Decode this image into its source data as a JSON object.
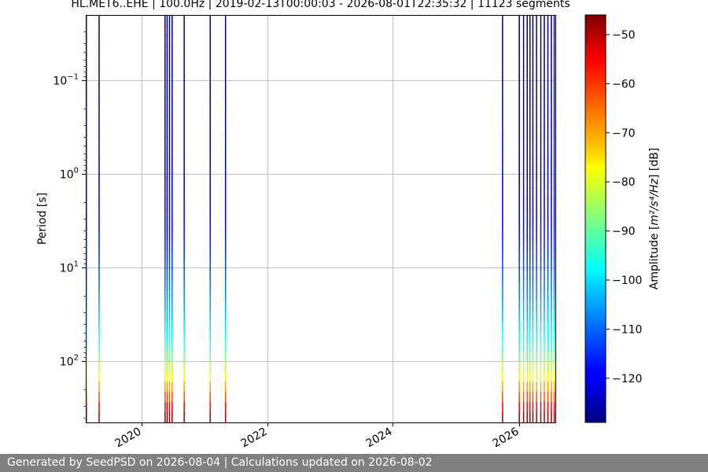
{
  "chart_data": {
    "type": "heatmap",
    "title": "HL.MET6..EHE | 100.0Hz | 2019-02-13T00:00:03 - 2026-08-01T22:35:32 | 11123 segments",
    "xlabel": "",
    "ylabel": "Period [s]",
    "x_axis": {
      "type": "date",
      "min": "2019-02-13",
      "max": "2026-08-01",
      "ticks": [
        "2020",
        "2022",
        "2024",
        "2026"
      ]
    },
    "y_axis": {
      "scale": "log",
      "inverted": true,
      "min": 0.02,
      "max": 450,
      "ticks": [
        {
          "value": 0.1,
          "base": "10",
          "exp": "−1"
        },
        {
          "value": 1,
          "base": "10",
          "exp": "0"
        },
        {
          "value": 10,
          "base": "10",
          "exp": "1"
        },
        {
          "value": 100,
          "base": "10",
          "exp": "2"
        }
      ]
    },
    "grid": true,
    "colorbar": {
      "label_prefix": "Amplitude [",
      "label_math": "m²/s⁴/Hz",
      "label_suffix": "] [dB]",
      "min": -129,
      "max": -46,
      "ticks": [
        "−50",
        "−60",
        "−70",
        "−80",
        "−90",
        "−100",
        "−110",
        "−120"
      ],
      "tick_values": [
        -50,
        -60,
        -70,
        -80,
        -90,
        -100,
        -110,
        -120
      ],
      "colormap": "jet"
    },
    "data_periods": [
      {
        "start": "2019-02-13",
        "end": "2019-02-16"
      },
      {
        "start": "2019-04-28",
        "end": "2019-05-03"
      },
      {
        "start": "2020-05-15",
        "end": "2020-05-18"
      },
      {
        "start": "2020-05-27",
        "end": "2020-05-30"
      },
      {
        "start": "2020-06-10",
        "end": "2020-06-13"
      },
      {
        "start": "2020-06-25",
        "end": "2020-06-28"
      },
      {
        "start": "2020-09-03",
        "end": "2020-09-05"
      },
      {
        "start": "2021-02-01",
        "end": "2021-02-04"
      },
      {
        "start": "2021-05-01",
        "end": "2021-05-03"
      },
      {
        "start": "2025-09-25",
        "end": "2025-09-28"
      },
      {
        "start": "2025-12-31",
        "end": "2026-01-03"
      },
      {
        "start": "2026-01-25",
        "end": "2026-01-30"
      },
      {
        "start": "2026-02-15",
        "end": "2026-02-20"
      },
      {
        "start": "2026-03-03",
        "end": "2026-03-09"
      },
      {
        "start": "2026-03-20",
        "end": "2026-03-27"
      },
      {
        "start": "2026-04-10",
        "end": "2026-04-15"
      },
      {
        "start": "2026-05-05",
        "end": "2026-05-10"
      },
      {
        "start": "2026-05-25",
        "end": "2026-06-01"
      },
      {
        "start": "2026-06-15",
        "end": "2026-06-20"
      },
      {
        "start": "2026-07-05",
        "end": "2026-07-10"
      },
      {
        "start": "2026-07-22",
        "end": "2026-07-28"
      }
    ],
    "amplitude_by_period": [
      {
        "period": 0.02,
        "db": -129
      },
      {
        "period": 0.1,
        "db": -128
      },
      {
        "period": 1,
        "db": -125
      },
      {
        "period": 3,
        "db": -120
      },
      {
        "period": 10,
        "db": -113
      },
      {
        "period": 30,
        "db": -104
      },
      {
        "period": 60,
        "db": -96
      },
      {
        "period": 100,
        "db": -86
      },
      {
        "period": 150,
        "db": -76
      },
      {
        "period": 200,
        "db": -68
      },
      {
        "period": 250,
        "db": -62
      },
      {
        "period": 300,
        "db": -57
      },
      {
        "period": 400,
        "db": -48
      },
      {
        "period": 450,
        "db": -46
      }
    ]
  },
  "footer": {
    "text": "Generated by SeedPSD on 2026-08-04 | Calculations updated on 2026-08-02"
  }
}
